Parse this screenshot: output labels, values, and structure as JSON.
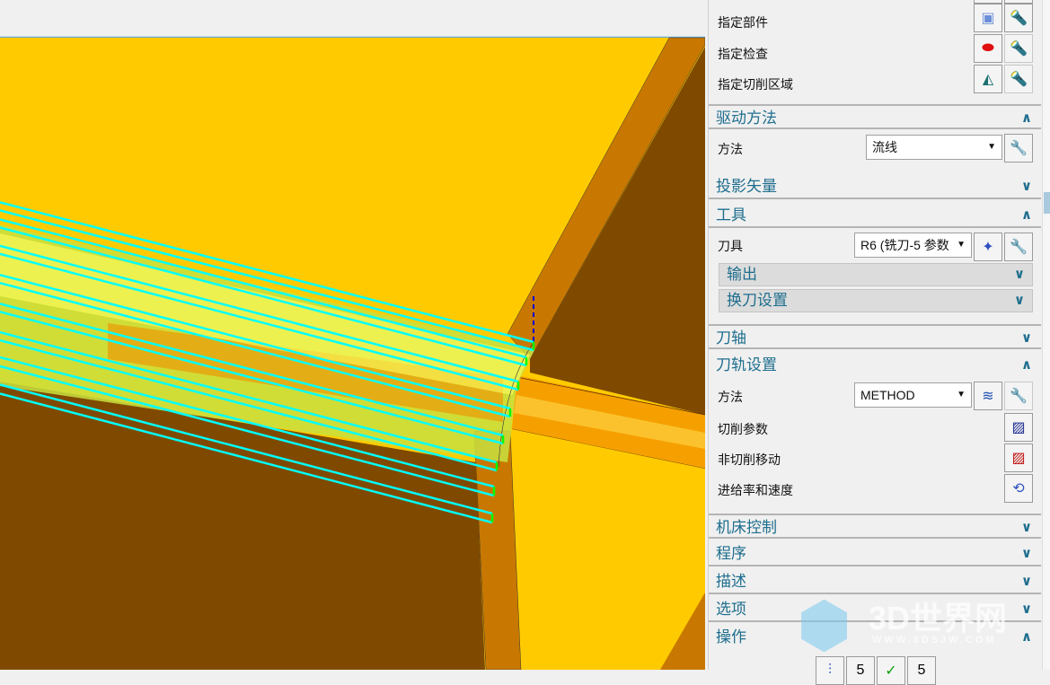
{
  "geometry_rows": [
    {
      "label": "指定部件"
    },
    {
      "label": "指定检查"
    },
    {
      "label": "指定切削区域"
    }
  ],
  "drive": {
    "title": "驱动方法",
    "method_label": "方法",
    "method_value": "流线"
  },
  "projection": {
    "title": "投影矢量"
  },
  "tool": {
    "title": "工具",
    "tool_label": "刀具",
    "tool_value": "R6 (铣刀-5 参数",
    "output": "输出",
    "tool_change": "换刀设置"
  },
  "axis": {
    "title": "刀轴"
  },
  "path": {
    "title": "刀轨设置",
    "method_label": "方法",
    "method_value": "METHOD",
    "cut_params": "切削参数",
    "non_cut": "非切削移动",
    "feeds": "进给率和速度"
  },
  "sections": {
    "machine": "机床控制",
    "program": "程序",
    "description": "描述",
    "options": "选项",
    "actions": "操作"
  },
  "actions": [
    "5",
    " ",
    "5"
  ],
  "watermark": {
    "name": "3D世界网",
    "url": "WWW.3DSJW.COM"
  },
  "colors": {
    "accent": "#1e6e8e",
    "toolpath": "#00ffff",
    "face_yellow": "#ffcb00",
    "face_orange": "#c87800",
    "face_brown": "#7f4a00"
  }
}
